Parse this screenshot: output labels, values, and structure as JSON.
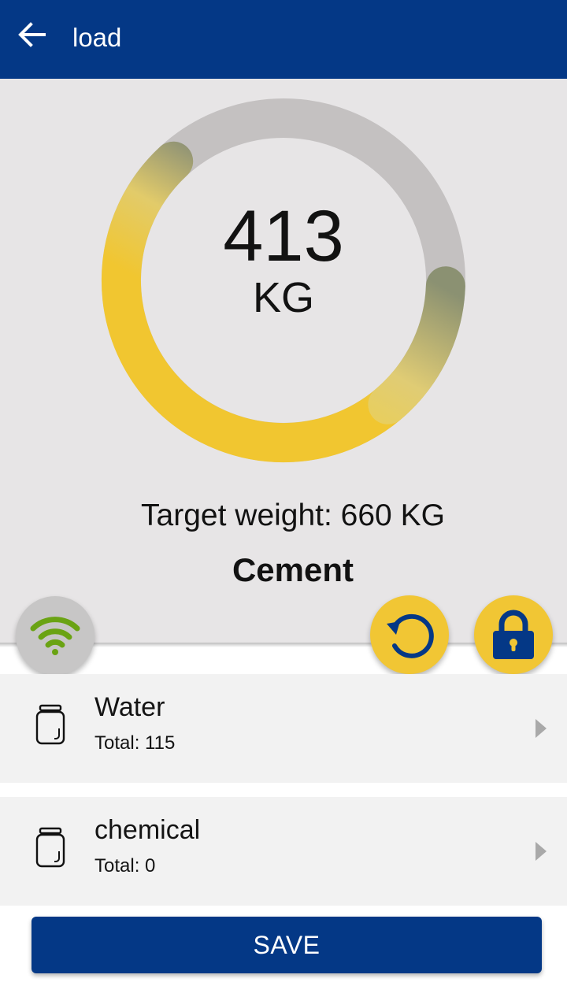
{
  "appbar": {
    "title": "load",
    "back_icon": "arrow-left-icon"
  },
  "gauge": {
    "current_weight": "413",
    "unit": "KG",
    "current_value": 413,
    "target_value": 660
  },
  "target": {
    "text": "Target weight: 660 KG"
  },
  "material": {
    "name": "Cement"
  },
  "actions": {
    "wifi_icon": "wifi-icon",
    "reset_icon": "reset-icon",
    "lock_icon": "lock-icon"
  },
  "items": [
    {
      "name": "Water",
      "total": "Total: 115",
      "icon": "jar-icon"
    },
    {
      "name": "chemical",
      "total": "Total: 0",
      "icon": "jar-icon"
    }
  ],
  "save_label": "SAVE",
  "colors": {
    "primary": "#043886",
    "accent": "#f1c634",
    "wifi_green": "#6aa313",
    "panel_bg": "#e7e5e6",
    "track": "#c4c1c1"
  }
}
